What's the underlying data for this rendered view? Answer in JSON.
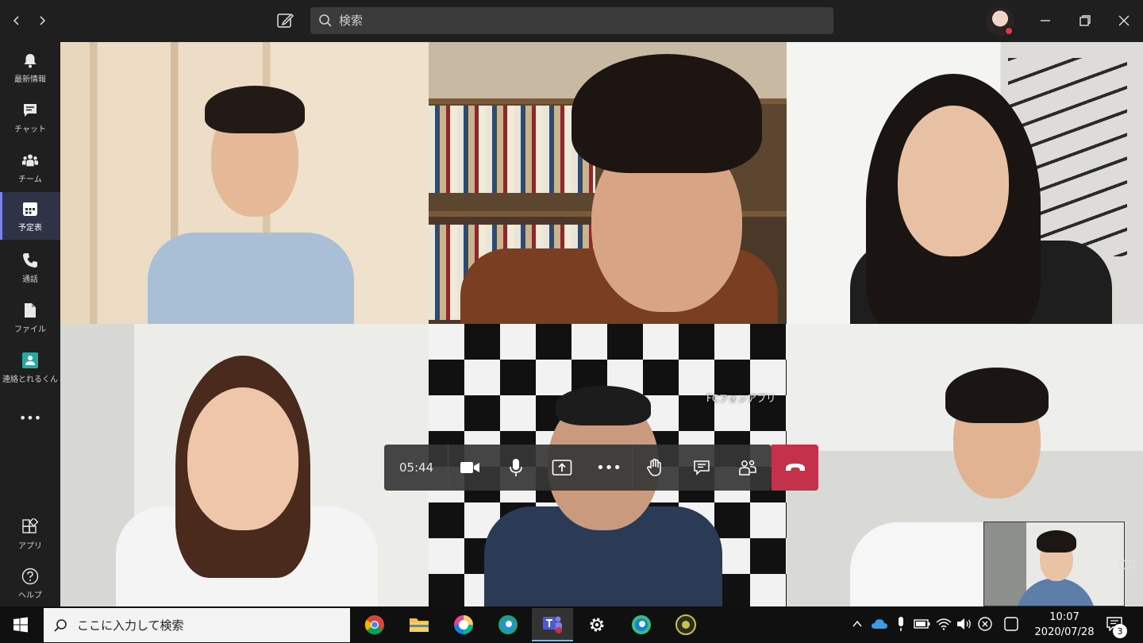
{
  "titlebar": {
    "search_placeholder": "検索"
  },
  "rail": {
    "items": [
      {
        "label": "最新情報",
        "icon": "bell-icon"
      },
      {
        "label": "チャット",
        "icon": "chat-icon"
      },
      {
        "label": "チーム",
        "icon": "teams-icon"
      },
      {
        "label": "予定表",
        "icon": "calendar-icon"
      },
      {
        "label": "通話",
        "icon": "phone-icon"
      },
      {
        "label": "ファイル",
        "icon": "file-icon"
      },
      {
        "label": "連絡とれるくん",
        "icon": "app-icon"
      }
    ],
    "more": "•••",
    "apps_label": "アプリ",
    "help_label": "ヘルプ"
  },
  "stage": {
    "tile5_overlay": "FCフォンアプリ"
  },
  "controls": {
    "timer": "05:44",
    "more": "•••"
  },
  "taskbar": {
    "search_placeholder": "ここに入力して検索",
    "time": "10:07",
    "date": "2020/07/28",
    "notification_count": "3"
  },
  "colors": {
    "accent": "#7b83eb",
    "hangup": "#c4314b",
    "rail_bg": "#1f1f1f"
  }
}
